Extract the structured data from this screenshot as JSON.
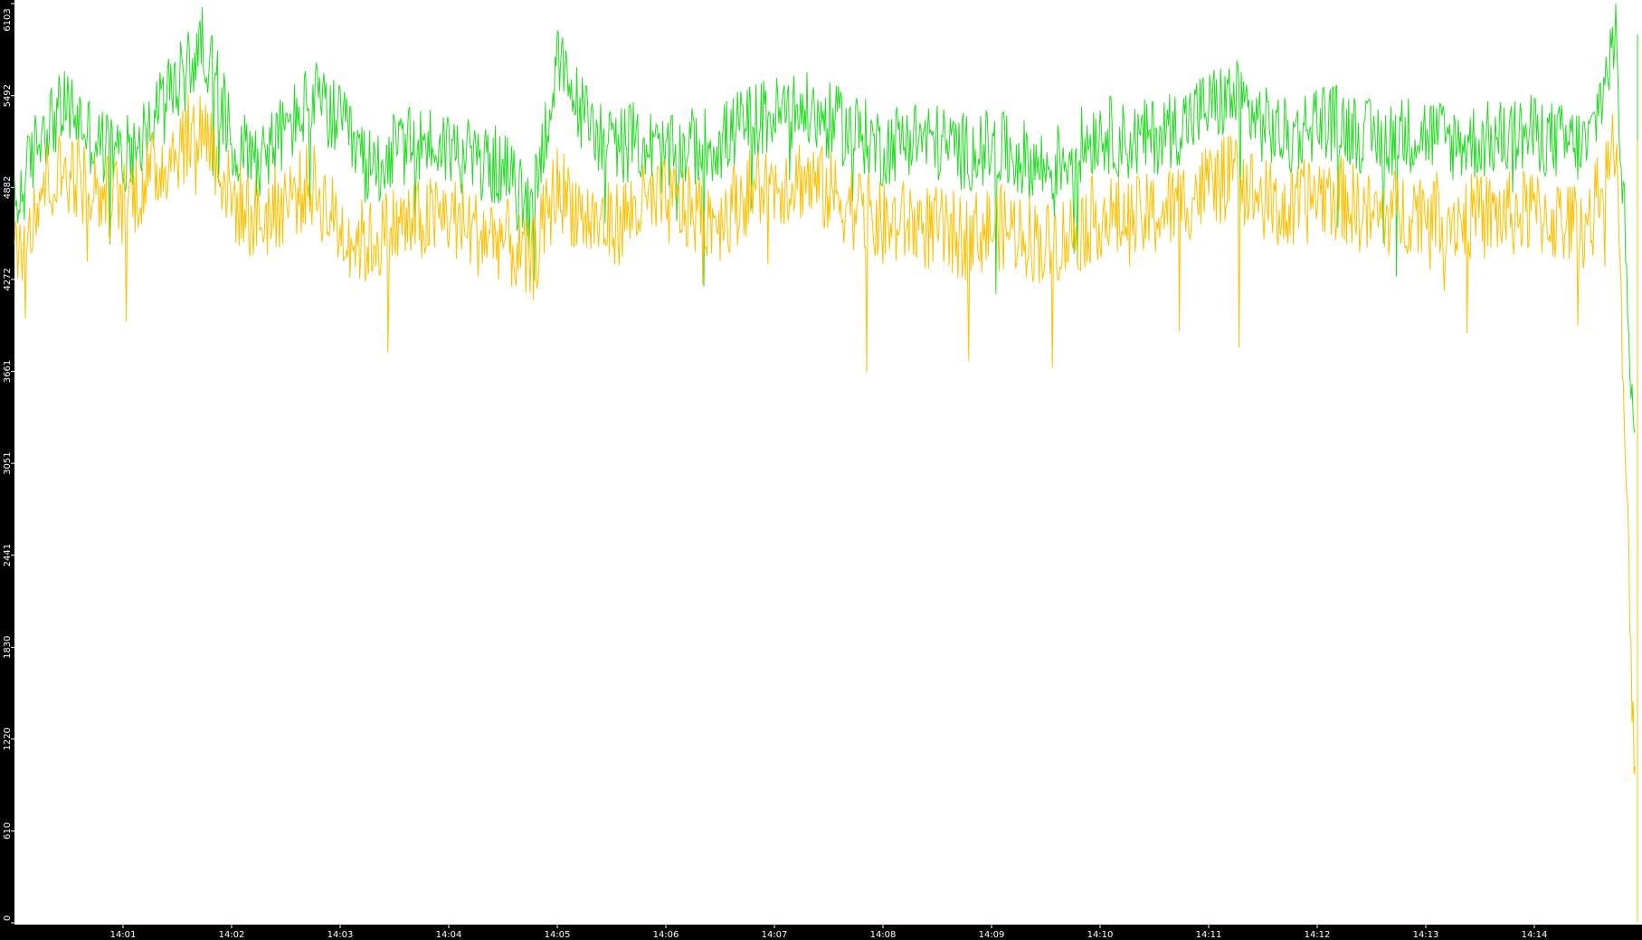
{
  "chart_data": {
    "type": "line",
    "title": "",
    "xlabel": "",
    "ylabel": "",
    "grid": false,
    "legend": "none",
    "background_color": "#ffffff",
    "axis_band_color": "#000000",
    "axis_text_color": "#ffffff",
    "x_start": "14:00:00",
    "x_end": "14:14:58",
    "xlim": [
      "14:00:00",
      "14:14:58"
    ],
    "ylim": [
      0,
      6103
    ],
    "y_ticks": [
      {
        "value": 0,
        "label": "0"
      },
      {
        "value": 610,
        "label": "610"
      },
      {
        "value": 1220,
        "label": "1220"
      },
      {
        "value": 1830,
        "label": "1830"
      },
      {
        "value": 2441,
        "label": "2441"
      },
      {
        "value": 3051,
        "label": "3051"
      },
      {
        "value": 3661,
        "label": "3661"
      },
      {
        "value": 4272,
        "label": "4272"
      },
      {
        "value": 4882,
        "label": "4882"
      },
      {
        "value": 5492,
        "label": "5492"
      },
      {
        "value": 6103,
        "label": "6103"
      }
    ],
    "x_ticks": [
      {
        "value": "14:01",
        "label": "14:01"
      },
      {
        "value": "14:02",
        "label": "14:02"
      },
      {
        "value": "14:03",
        "label": "14:03"
      },
      {
        "value": "14:04",
        "label": "14:04"
      },
      {
        "value": "14:05",
        "label": "14:05"
      },
      {
        "value": "14:06",
        "label": "14:06"
      },
      {
        "value": "14:07",
        "label": "14:07"
      },
      {
        "value": "14:08",
        "label": "14:08"
      },
      {
        "value": "14:09",
        "label": "14:09"
      },
      {
        "value": "14:10",
        "label": "14:10"
      },
      {
        "value": "14:11",
        "label": "14:11"
      },
      {
        "value": "14:12",
        "label": "14:12"
      },
      {
        "value": "14:13",
        "label": "14:13"
      },
      {
        "value": "14:14",
        "label": "14:14"
      }
    ],
    "series": [
      {
        "color": "#22dd22",
        "x": [
          "14:00:00",
          "14:00:15",
          "14:00:30",
          "14:00:45",
          "14:01:00",
          "14:01:15",
          "14:01:30",
          "14:01:45",
          "14:02:00",
          "14:02:15",
          "14:02:30",
          "14:02:45",
          "14:03:00",
          "14:03:15",
          "14:03:30",
          "14:03:45",
          "14:04:00",
          "14:04:15",
          "14:04:30",
          "14:04:45",
          "14:05:00",
          "14:05:15",
          "14:05:30",
          "14:05:45",
          "14:06:00",
          "14:06:15",
          "14:06:30",
          "14:06:45",
          "14:07:00",
          "14:07:15",
          "14:07:30",
          "14:07:45",
          "14:08:00",
          "14:08:15",
          "14:08:30",
          "14:08:45",
          "14:09:00",
          "14:09:15",
          "14:09:30",
          "14:09:45",
          "14:10:00",
          "14:10:15",
          "14:10:30",
          "14:10:45",
          "14:11:00",
          "14:11:15",
          "14:11:30",
          "14:11:45",
          "14:12:00",
          "14:12:15",
          "14:12:30",
          "14:12:45",
          "14:13:00",
          "14:13:15",
          "14:13:30",
          "14:13:45",
          "14:14:00",
          "14:14:15",
          "14:14:30",
          "14:14:45",
          "14:14:58"
        ],
        "values": [
          4700,
          5280,
          5420,
          5180,
          5080,
          5300,
          5560,
          5850,
          5200,
          5080,
          5260,
          5480,
          5300,
          5000,
          5120,
          5180,
          5150,
          5050,
          5020,
          4700,
          5700,
          5350,
          5150,
          5200,
          5080,
          5150,
          5180,
          5320,
          5360,
          5400,
          5320,
          5250,
          5140,
          5230,
          5180,
          5120,
          5140,
          5090,
          5000,
          5120,
          5260,
          5180,
          5220,
          5300,
          5420,
          5480,
          5300,
          5200,
          5340,
          5300,
          5200,
          5230,
          5250,
          5180,
          5190,
          5210,
          5240,
          5180,
          5150,
          5900,
          2500
        ]
      },
      {
        "color": "#ffc000",
        "x": [
          "14:00:00",
          "14:00:15",
          "14:00:30",
          "14:00:45",
          "14:01:00",
          "14:01:15",
          "14:01:30",
          "14:01:45",
          "14:02:00",
          "14:02:15",
          "14:02:30",
          "14:02:45",
          "14:03:00",
          "14:03:15",
          "14:03:30",
          "14:03:45",
          "14:04:00",
          "14:04:15",
          "14:04:30",
          "14:04:45",
          "14:05:00",
          "14:05:15",
          "14:05:30",
          "14:05:45",
          "14:06:00",
          "14:06:15",
          "14:06:30",
          "14:06:45",
          "14:07:00",
          "14:07:15",
          "14:07:30",
          "14:07:45",
          "14:08:00",
          "14:08:15",
          "14:08:30",
          "14:08:45",
          "14:09:00",
          "14:09:15",
          "14:09:30",
          "14:09:45",
          "14:10:00",
          "14:10:15",
          "14:10:30",
          "14:10:45",
          "14:11:00",
          "14:11:15",
          "14:11:30",
          "14:11:45",
          "14:12:00",
          "14:12:15",
          "14:12:30",
          "14:12:45",
          "14:13:00",
          "14:13:15",
          "14:13:30",
          "14:13:45",
          "14:14:00",
          "14:14:15",
          "14:14:30",
          "14:14:45",
          "14:14:58"
        ],
        "values": [
          4400,
          4900,
          5000,
          4850,
          4780,
          4950,
          5150,
          5300,
          4800,
          4650,
          4800,
          4900,
          4600,
          4500,
          4620,
          4650,
          4700,
          4580,
          4550,
          4350,
          4900,
          4680,
          4620,
          4750,
          4780,
          4720,
          4680,
          4850,
          4900,
          4950,
          4850,
          4750,
          4620,
          4650,
          4600,
          4550,
          4620,
          4600,
          4500,
          4580,
          4700,
          4650,
          4700,
          4780,
          4900,
          4950,
          4800,
          4700,
          4850,
          4800,
          4680,
          4720,
          4750,
          4680,
          4690,
          4700,
          4720,
          4650,
          4620,
          5200,
          0
        ]
      }
    ]
  }
}
